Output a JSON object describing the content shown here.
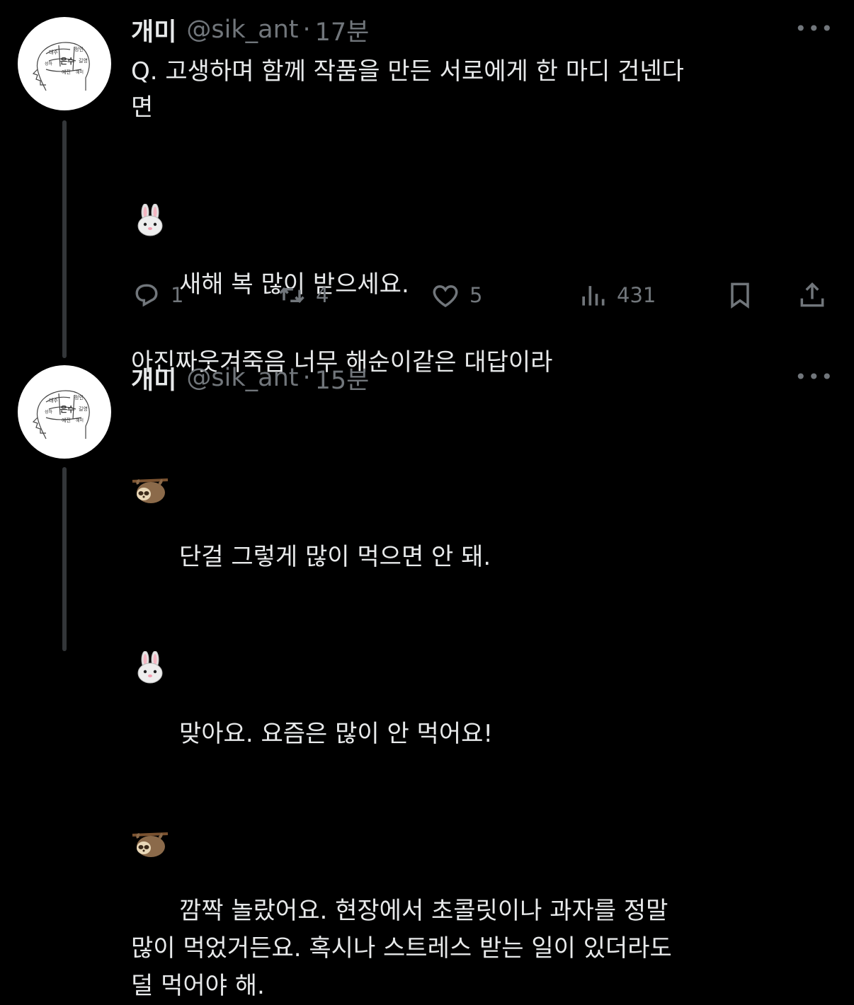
{
  "tweets": [
    {
      "name": "개미",
      "handle": "@sik_ant",
      "dot": "·",
      "time": "17분",
      "more_icon": "more-horizontal-icon",
      "lines": [
        {
          "emoji": null,
          "text": "Q. 고생하며 함께 작품을 만든 서로에게 한 마디 건넨다"
        },
        {
          "emoji": null,
          "text": "면"
        },
        {
          "emoji": "rabbit-face",
          "text": "새해 복 많이 받으세요."
        },
        {
          "emoji": null,
          "text": ""
        },
        {
          "emoji": null,
          "text": "아진짜웃겨죽음 너무 해순이같은 대답이라"
        }
      ],
      "actions": {
        "reply": {
          "icon": "reply-icon",
          "count": "1"
        },
        "retweet": {
          "icon": "retweet-icon",
          "count": "4"
        },
        "like": {
          "icon": "heart-icon",
          "count": "5"
        },
        "views": {
          "icon": "views-icon",
          "count": "431"
        },
        "bookmark": {
          "icon": "bookmark-icon"
        },
        "share": {
          "icon": "share-icon"
        }
      }
    },
    {
      "name": "개미",
      "handle": "@sik_ant",
      "dot": "·",
      "time": "15분",
      "more_icon": "more-horizontal-icon",
      "lines": [
        {
          "emoji": "sloth",
          "text": "단걸 그렇게 많이 먹으면 안 돼."
        },
        {
          "emoji": "rabbit-face",
          "text": "맞아요. 요즘은 많이 안 먹어요!"
        },
        {
          "emoji": "sloth",
          "text": "깜짝 놀랐어요. 현장에서 초콜릿이나 과자를 정말"
        },
        {
          "emoji": null,
          "text": "많이 먹었거든요. 혹시나 스트레스 받는 일이 있더라도"
        },
        {
          "emoji": null,
          "text": "덜 먹어야 해."
        }
      ]
    }
  ],
  "avatar_labels": [
    "태주",
    "정인",
    "은수",
    "길영",
    "성하",
    "예진",
    "혜미"
  ],
  "colors": {
    "background": "#000000",
    "text": "#e7e9ea",
    "muted": "#71767b",
    "thread_line": "#333639"
  }
}
